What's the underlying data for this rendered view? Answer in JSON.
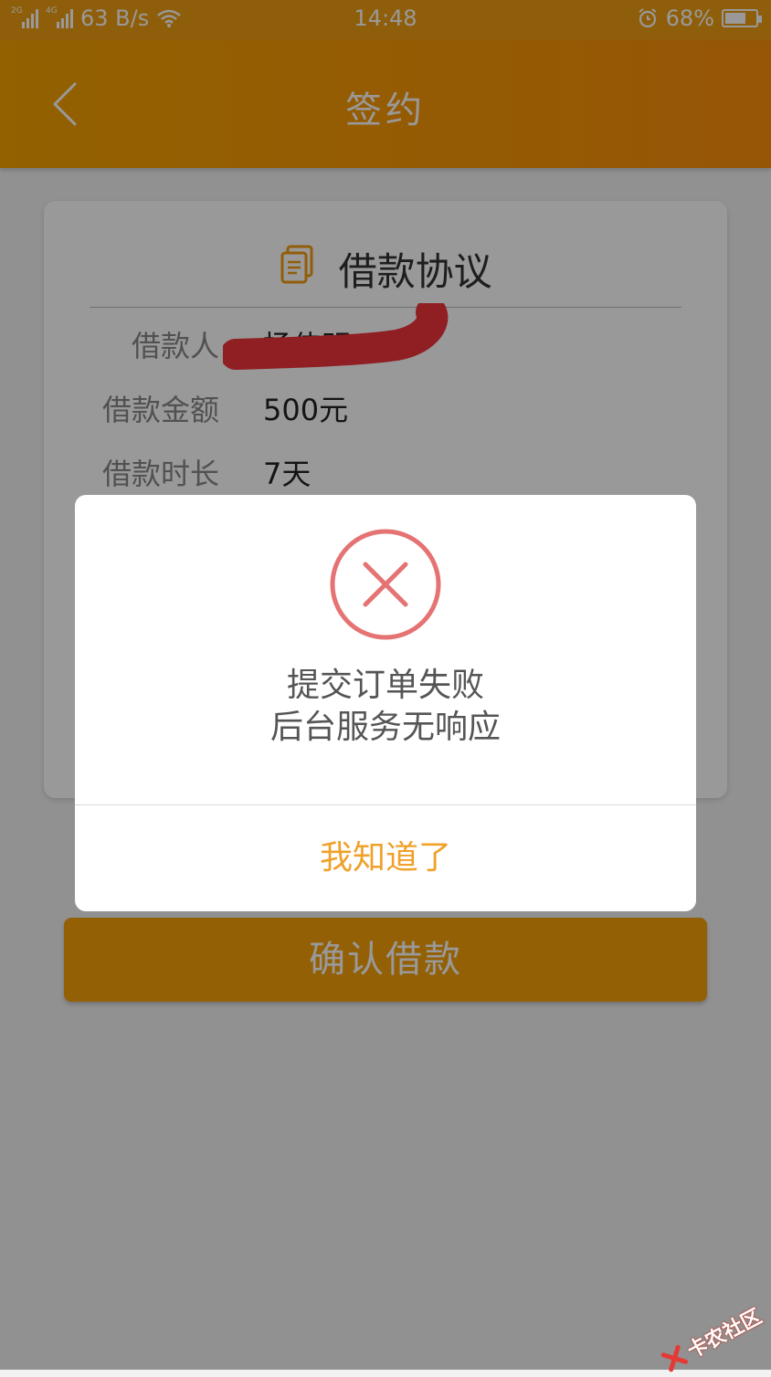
{
  "status_bar": {
    "network_1": "2G",
    "network_2": "4G",
    "speed": "63 B/s",
    "time": "14:48",
    "battery": "68%",
    "battery_level": 0.68
  },
  "header": {
    "title": "签约"
  },
  "agreement": {
    "title": "借款协议",
    "rows": [
      {
        "label": "借款人",
        "value": "杨伟明"
      },
      {
        "label": "借款金额",
        "value": "500元"
      },
      {
        "label": "借款时长",
        "value": "7天"
      }
    ]
  },
  "confirm_button": {
    "label": "确认借款"
  },
  "dialog": {
    "line1": "提交订单失败",
    "line2": "后台服务无响应",
    "button": "我知道了"
  },
  "watermark": {
    "text": "卡农社区"
  },
  "colors": {
    "accent": "#f5a201",
    "error": "#e57373",
    "dialog_button": "#f0a12a",
    "redaction": "#f0343c"
  }
}
